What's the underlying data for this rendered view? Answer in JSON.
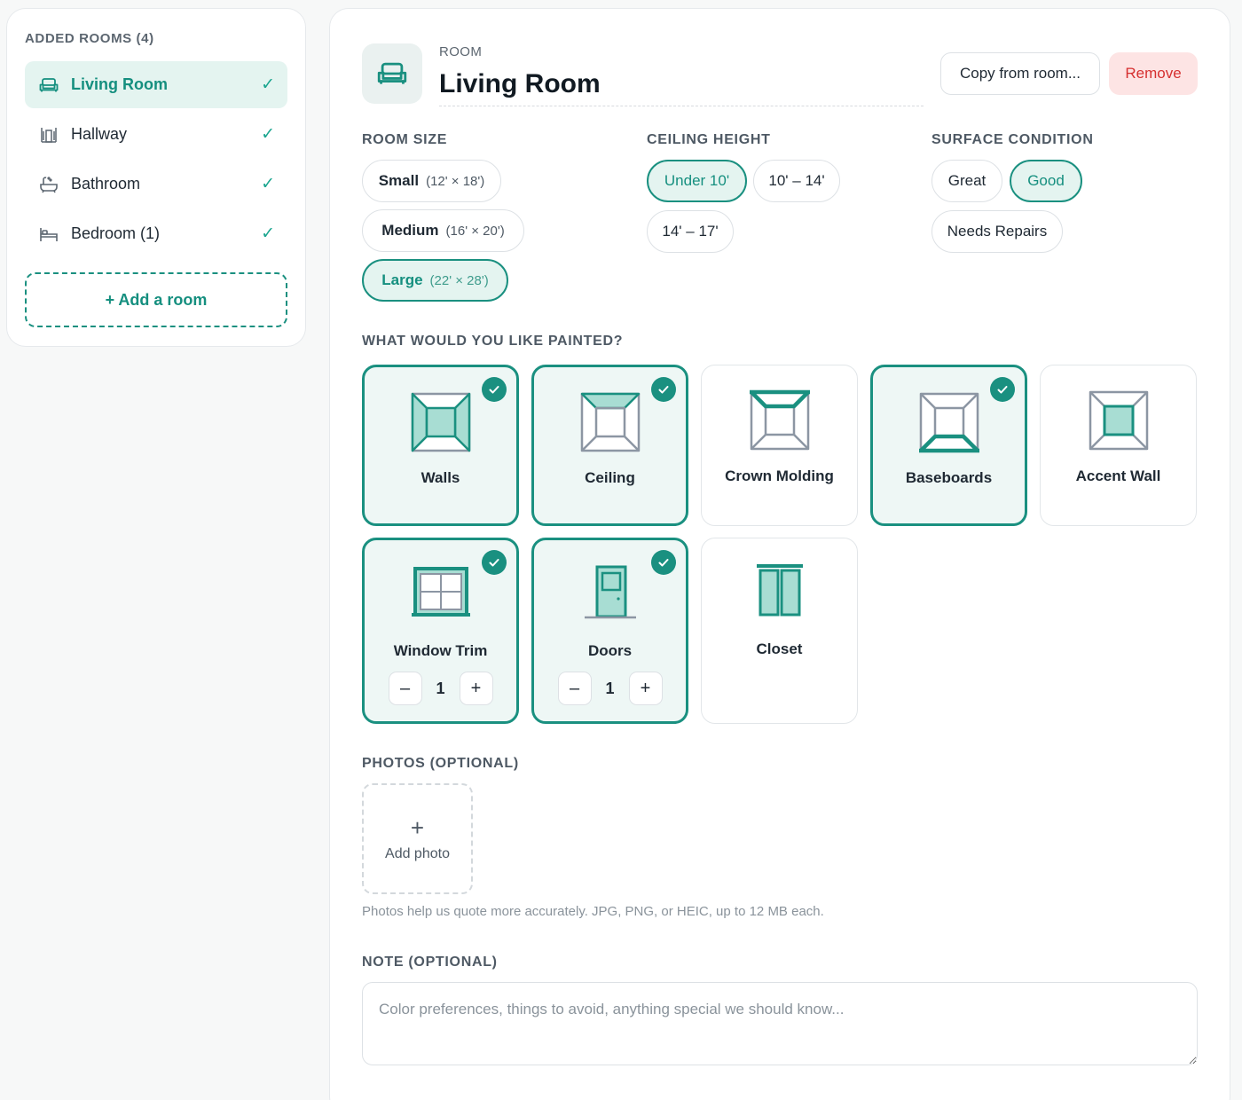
{
  "sidebar": {
    "title": "ADDED ROOMS (4)",
    "rooms": [
      {
        "label": "Living Room",
        "icon": "sofa-icon",
        "active": true
      },
      {
        "label": "Hallway",
        "icon": "hallway-icon",
        "active": false
      },
      {
        "label": "Bathroom",
        "icon": "bathtub-icon",
        "active": false
      },
      {
        "label": "Bedroom (1)",
        "icon": "bed-icon",
        "active": false
      }
    ],
    "check": "✓",
    "add_room": "+ Add a room"
  },
  "header": {
    "kicker": "ROOM",
    "title": "Living Room",
    "copy_label": "Copy from room...",
    "remove_label": "Remove"
  },
  "room_size": {
    "label": "ROOM SIZE",
    "options": [
      {
        "name": "Small",
        "dims": "(12' × 18')",
        "selected": false
      },
      {
        "name": "Medium",
        "dims": "(16' × 20')",
        "selected": false
      },
      {
        "name": "Large",
        "dims": "(22' × 28')",
        "selected": true
      }
    ]
  },
  "ceiling_height": {
    "label": "CEILING HEIGHT",
    "options": [
      {
        "name": "Under 10'",
        "selected": true
      },
      {
        "name": "10' – 14'",
        "selected": false
      },
      {
        "name": "14' – 17'",
        "selected": false
      }
    ]
  },
  "surface_condition": {
    "label": "SURFACE CONDITION",
    "options": [
      {
        "name": "Great",
        "selected": false
      },
      {
        "name": "Good",
        "selected": true
      },
      {
        "name": "Needs Repairs",
        "selected": false
      }
    ]
  },
  "painted": {
    "label": "WHAT WOULD YOU LIKE PAINTED?",
    "items": [
      {
        "label": "Walls",
        "selected": true,
        "icon": "walls-icon"
      },
      {
        "label": "Ceiling",
        "selected": true,
        "icon": "ceiling-icon"
      },
      {
        "label": "Crown Molding",
        "selected": false,
        "icon": "crown-molding-icon"
      },
      {
        "label": "Baseboards",
        "selected": true,
        "icon": "baseboards-icon"
      },
      {
        "label": "Accent Wall",
        "selected": false,
        "icon": "accent-wall-icon"
      },
      {
        "label": "Window Trim",
        "selected": true,
        "icon": "window-icon",
        "count": "1"
      },
      {
        "label": "Doors",
        "selected": true,
        "icon": "door-icon",
        "count": "1"
      },
      {
        "label": "Closet",
        "selected": false,
        "icon": "closet-icon"
      }
    ],
    "minus": "–",
    "plus": "+"
  },
  "photos": {
    "label": "PHOTOS (OPTIONAL)",
    "add_plus": "+",
    "add_label": "Add photo",
    "help": "Photos help us quote more accurately. JPG, PNG, or HEIC, up to 12 MB each."
  },
  "note": {
    "label": "NOTE (OPTIONAL)",
    "placeholder": "Color preferences, things to avoid, anything special we should know..."
  },
  "colors": {
    "accent": "#1a9080",
    "accent_bg": "#e4f4f0",
    "danger": "#d63030",
    "danger_bg": "#fde4e4"
  }
}
